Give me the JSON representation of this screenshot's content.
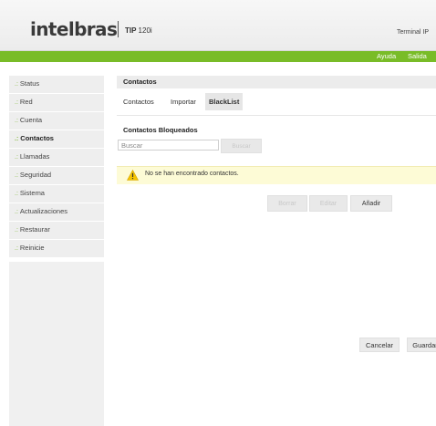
{
  "header": {
    "brand": "intelbras",
    "model_prefix": "TIP",
    "model_number": "120i",
    "terminal_label": "Terminal IP"
  },
  "topbar": {
    "links": [
      "Ayuda",
      "Salida"
    ]
  },
  "sidebar": {
    "bullet": ".:",
    "items": [
      {
        "label": "Status"
      },
      {
        "label": "Red"
      },
      {
        "label": "Cuenta"
      },
      {
        "label": "Contactos",
        "active": true
      },
      {
        "label": "Llamadas"
      },
      {
        "label": "Seguridad"
      },
      {
        "label": "Sistema"
      },
      {
        "label": "Actualizaciones"
      },
      {
        "label": "Restaurar"
      },
      {
        "label": "Reinicie"
      }
    ]
  },
  "main": {
    "title": "Contactos",
    "tabs": [
      {
        "label": "Contactos"
      },
      {
        "label": "Importar"
      },
      {
        "label": "BlackList",
        "active": true
      }
    ],
    "section_title": "Contactos Bloqueados",
    "search": {
      "placeholder": "Buscar",
      "button": "Buscar"
    },
    "alert": {
      "text": "No se han encontrado contactos.",
      "icon": "warning-icon"
    },
    "actions": {
      "delete": "Borrar",
      "edit": "Editar",
      "add": "Añadir"
    }
  },
  "footer": {
    "cancel": "Cancelar",
    "save": "Guardar"
  },
  "colors": {
    "accent_green": "#79bc28",
    "alert_bg": "#fdfbd6",
    "warning_yellow": "#f5c400"
  }
}
